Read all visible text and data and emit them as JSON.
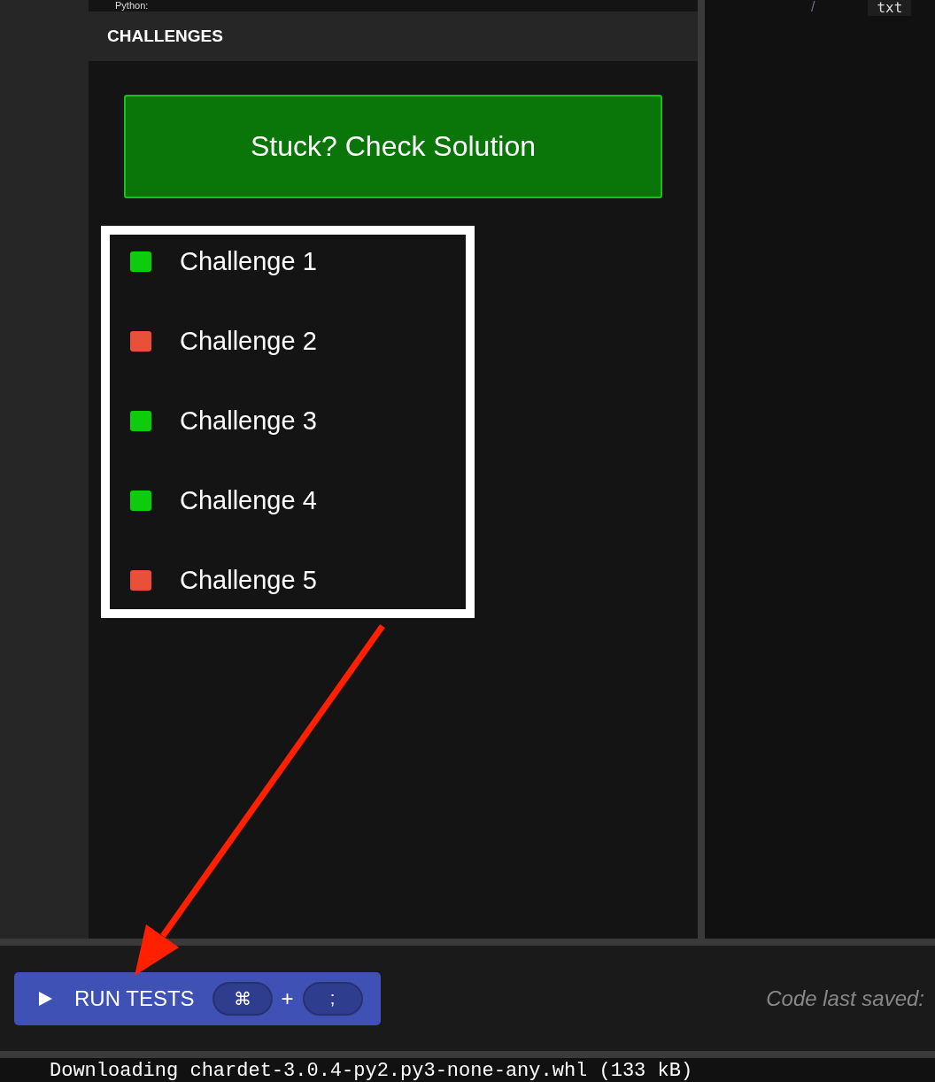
{
  "editor_top": {
    "text": "Python:"
  },
  "right_editor": {
    "slash": "/",
    "text": "txt"
  },
  "challenges_panel": {
    "title": "CHALLENGES",
    "solution_button": "Stuck? Check Solution",
    "challenges": [
      {
        "label": "Challenge 1",
        "color": "#0ccc0c"
      },
      {
        "label": "Challenge 2",
        "color": "#e8503a"
      },
      {
        "label": "Challenge 3",
        "color": "#0ccc0c"
      },
      {
        "label": "Challenge 4",
        "color": "#0ccc0c"
      },
      {
        "label": "Challenge 5",
        "color": "#e8503a"
      }
    ]
  },
  "footer": {
    "run_button": {
      "label": "RUN TESTS",
      "keys": [
        "⌘",
        "+",
        ";"
      ]
    },
    "save_status": "Code last saved:"
  },
  "terminal": {
    "line": "Downloading chardet-3.0.4-py2.py3-none-any.whl (133 kB)"
  }
}
